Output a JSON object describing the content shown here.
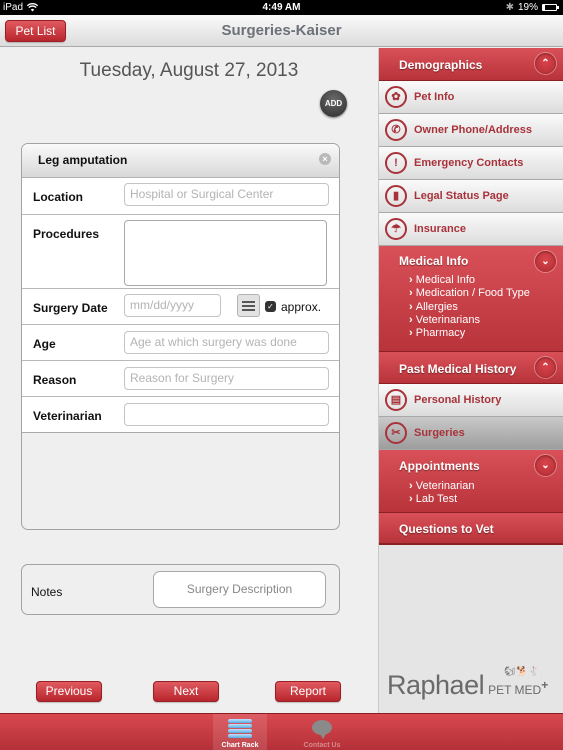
{
  "status_bar": {
    "device": "iPad",
    "time": "4:49 AM",
    "battery": "19%",
    "battery_level": 0.19,
    "icons": [
      "wifi-icon",
      "bluetooth-icon",
      "battery-icon"
    ]
  },
  "nav": {
    "back_label": "Pet List",
    "title": "Surgeries-Kaiser"
  },
  "main": {
    "date": "Tuesday, August 27, 2013",
    "add_label": "ADD",
    "card": {
      "title": "Leg amputation",
      "close_glyph": "×",
      "fields": {
        "location": {
          "label": "Location",
          "value": "",
          "placeholder": "Hospital or Surgical Center"
        },
        "procedures": {
          "label": "Procedures",
          "value": ""
        },
        "surgery_date": {
          "label": "Surgery Date",
          "value": "",
          "placeholder": "mm/dd/yyyy",
          "approx_label": "approx.",
          "approx_checked": true,
          "check_glyph": "✓"
        },
        "age": {
          "label": "Age",
          "value": "",
          "placeholder": "Age at which surgery was done"
        },
        "reason": {
          "label": "Reason",
          "value": "",
          "placeholder": "Reason for Surgery"
        },
        "veterinarian": {
          "label": "Veterinarian",
          "value": ""
        }
      }
    },
    "notes": {
      "label": "Notes",
      "button_label": "Surgery Description"
    },
    "buttons": {
      "previous": "Previous",
      "next": "Next",
      "report": "Report"
    }
  },
  "sidebar": {
    "sections": [
      {
        "title": "Demographics",
        "toggle": "^",
        "items": [
          {
            "label": "Pet Info",
            "icon": "paw-icon",
            "glyph": "✿"
          },
          {
            "label": "Owner Phone/Address",
            "icon": "phone-icon",
            "glyph": "✆"
          },
          {
            "label": "Emergency Contacts",
            "icon": "siren-icon",
            "glyph": "!"
          },
          {
            "label": "Legal Status Page",
            "icon": "signal-bars-icon",
            "glyph": "▮"
          },
          {
            "label": "Insurance",
            "icon": "umbrella-icon",
            "glyph": "☂"
          }
        ]
      },
      {
        "title": "Medical Info",
        "toggle": "v",
        "subitems": [
          "Medical Info",
          "Medication / Food Type",
          "Allergies",
          "Veterinarians",
          "Pharmacy"
        ]
      },
      {
        "title": "Past Medical History",
        "toggle": "^",
        "items": [
          {
            "label": "Personal History",
            "icon": "clipboard-icon",
            "glyph": "▤"
          },
          {
            "label": "Surgeries",
            "icon": "scissors-icon",
            "glyph": "✂",
            "active": true
          }
        ]
      },
      {
        "title": "Appointments",
        "toggle": "v",
        "subitems": [
          "Veterinarian",
          "Lab Test"
        ]
      },
      {
        "title": "Questions to Vet"
      }
    ],
    "logo": {
      "name": "Raphael",
      "suffix": "PET MED",
      "plus": "+"
    }
  },
  "tabbar": {
    "tabs": [
      {
        "label": "Chart Rack",
        "icon": "chart-rack-icon",
        "active": true
      },
      {
        "label": "Contact Us",
        "icon": "speech-bubble-icon",
        "active": false
      }
    ]
  },
  "colors": {
    "accent_red": "#c0393f",
    "sidebar_item_text": "#a8323a",
    "background": "#efefef"
  }
}
